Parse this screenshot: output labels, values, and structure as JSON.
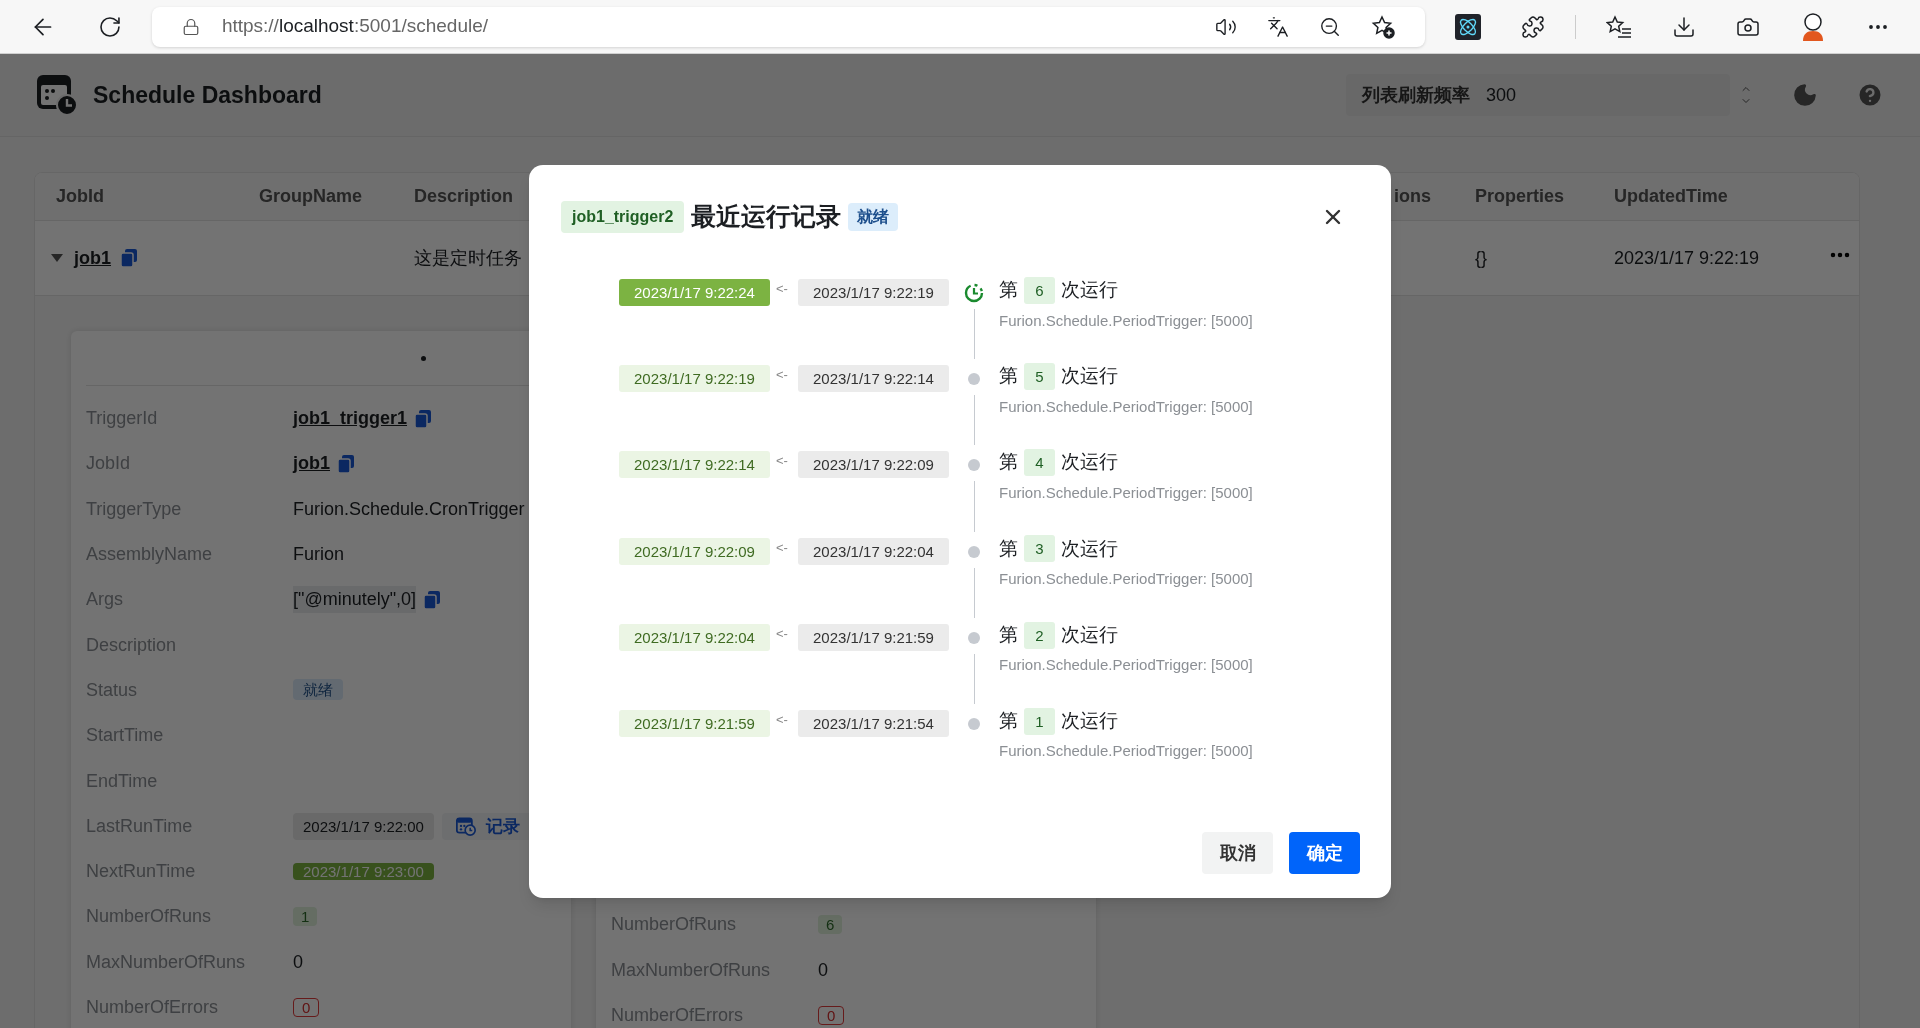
{
  "browser": {
    "url": "https://**localhost**:5001/schedule/"
  },
  "header": {
    "title": "Schedule Dashboard",
    "refresh": {
      "label": "列表刷新频率",
      "value": "300"
    }
  },
  "table": {
    "columns": [
      "JobId",
      "GroupName",
      "Description",
      "ions",
      "Properties",
      "UpdatedTime"
    ],
    "rows": [
      {
        "expanded": true,
        "job_id": "job1",
        "description": "这是定时任务",
        "properties": "{}",
        "updated_time": "2023/1/17 9:22:19"
      }
    ]
  },
  "trigger_panels": [
    {
      "fields": [
        {
          "label": "TriggerId",
          "kind": "link",
          "value": "job1_trigger1"
        },
        {
          "label": "JobId",
          "kind": "link",
          "value": "job1"
        },
        {
          "label": "TriggerType",
          "kind": "text",
          "value": "Furion.Schedule.CronTrigger"
        },
        {
          "label": "AssemblyName",
          "kind": "text",
          "value": "Furion"
        },
        {
          "label": "Args",
          "kind": "code",
          "value": "[\"@minutely\",0]"
        },
        {
          "label": "Description",
          "kind": "text"
        },
        {
          "label": "Status",
          "kind": "status",
          "value": "就绪"
        },
        {
          "label": "StartTime",
          "kind": "text"
        },
        {
          "label": "EndTime",
          "kind": "text"
        },
        {
          "label": "LastRunTime",
          "kind": "last-run",
          "value": "2023/1/17 9:22:00",
          "action": "记录"
        },
        {
          "label": "NextRunTime",
          "kind": "next-run",
          "value": "2023/1/17 9:23:00"
        },
        {
          "label": "NumberOfRuns",
          "kind": "count",
          "value": "1"
        },
        {
          "label": "MaxNumberOfRuns",
          "kind": "text",
          "value": "0"
        },
        {
          "label": "NumberOfErrors",
          "kind": "errors",
          "value": "0"
        }
      ]
    },
    {
      "fields": [
        {
          "label": "NumberOfRuns",
          "kind": "count",
          "value": "6"
        },
        {
          "label": "MaxNumberOfRuns",
          "kind": "text",
          "value": "0"
        },
        {
          "label": "NumberOfErrors",
          "kind": "errors",
          "value": "0"
        }
      ]
    }
  ],
  "dialog": {
    "trigger_id": "job1_trigger2",
    "title": "最近运行记录",
    "status": "就绪",
    "runs": [
      {
        "current": true,
        "last": "2023/1/17 9:22:24",
        "arrow": "<-",
        "previous": "2023/1/17 9:22:19",
        "prefix": "第",
        "number": "6",
        "suffix": "次运行",
        "detail": "Furion.Schedule.PeriodTrigger: [5000]"
      },
      {
        "current": false,
        "last": "2023/1/17 9:22:19",
        "arrow": "<-",
        "previous": "2023/1/17 9:22:14",
        "prefix": "第",
        "number": "5",
        "suffix": "次运行",
        "detail": "Furion.Schedule.PeriodTrigger: [5000]"
      },
      {
        "current": false,
        "last": "2023/1/17 9:22:14",
        "arrow": "<-",
        "previous": "2023/1/17 9:22:09",
        "prefix": "第",
        "number": "4",
        "suffix": "次运行",
        "detail": "Furion.Schedule.PeriodTrigger: [5000]"
      },
      {
        "current": false,
        "last": "2023/1/17 9:22:09",
        "arrow": "<-",
        "previous": "2023/1/17 9:22:04",
        "prefix": "第",
        "number": "3",
        "suffix": "次运行",
        "detail": "Furion.Schedule.PeriodTrigger: [5000]"
      },
      {
        "current": false,
        "last": "2023/1/17 9:22:04",
        "arrow": "<-",
        "previous": "2023/1/17 9:21:59",
        "prefix": "第",
        "number": "2",
        "suffix": "次运行",
        "detail": "Furion.Schedule.PeriodTrigger: [5000]"
      },
      {
        "current": false,
        "last": "2023/1/17 9:21:59",
        "arrow": "<-",
        "previous": "2023/1/17 9:21:54",
        "prefix": "第",
        "number": "1",
        "suffix": "次运行",
        "detail": "Furion.Schedule.PeriodTrigger: [5000]"
      }
    ],
    "buttons": [
      {
        "label": "取消",
        "kind": "secondary"
      },
      {
        "label": "确定",
        "kind": "primary"
      }
    ]
  }
}
